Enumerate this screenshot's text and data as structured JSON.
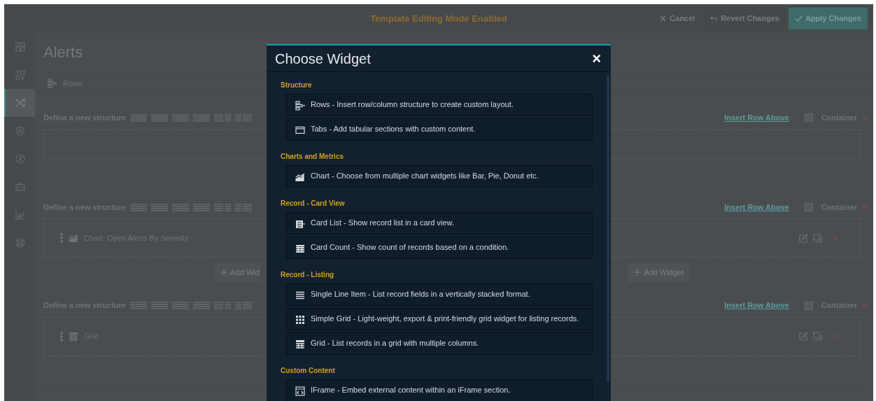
{
  "top_bar": {
    "mode_label": "Template Editing Mode Enabled",
    "buttons": [
      {
        "kind": "cancel",
        "label": "Cancel"
      },
      {
        "kind": "revert",
        "label": "Revert Changes"
      },
      {
        "kind": "apply",
        "label": "Apply Changes"
      }
    ]
  },
  "sidebar": {
    "items": [
      {
        "kind": "dashboard",
        "selected": false
      },
      {
        "kind": "sort",
        "selected": false
      },
      {
        "kind": "shuffle",
        "selected": true
      },
      {
        "kind": "shield",
        "selected": false
      },
      {
        "kind": "compass",
        "selected": false
      },
      {
        "kind": "briefcase",
        "selected": false
      },
      {
        "kind": "chart",
        "selected": false
      },
      {
        "kind": "lifebuoy",
        "selected": false
      }
    ]
  },
  "page": {
    "title": "Alerts",
    "rows_label": "Rows"
  },
  "structures": [
    {
      "label": "Define a new structure",
      "insert_link": "Insert Row Above",
      "container_label": "Container",
      "container_checked": false
    },
    {
      "label": "Define a new structure",
      "insert_link": "Insert Row Above",
      "container_label": "Container",
      "container_checked": false,
      "widgets": [
        {
          "kind": "chart",
          "label": "Chart: Open Alerts By Severity"
        }
      ],
      "add_buttons": [
        "Add Wid",
        "Add Widget"
      ]
    },
    {
      "label": "Define a new structure",
      "insert_link": "Insert Row Above",
      "container_label": "Container",
      "container_checked": false,
      "widgets": [
        {
          "kind": "grid",
          "label": "Grid"
        }
      ]
    }
  ],
  "modal": {
    "title": "Choose Widget",
    "close": "×",
    "groups": [
      {
        "heading": "Structure",
        "items": [
          {
            "kind": "rows",
            "text": "Rows - Insert row/column structure to create custom layout."
          },
          {
            "kind": "tabs",
            "text": "Tabs - Add tabular sections with custom content."
          }
        ]
      },
      {
        "heading": "Charts and Metrics",
        "items": [
          {
            "kind": "chart",
            "text": "Chart - Choose from multiple chart widgets like Bar, Pie, Donut etc."
          }
        ]
      },
      {
        "heading": "Record - Card View",
        "items": [
          {
            "kind": "cardlist",
            "text": "Card List - Show record list in a card view."
          },
          {
            "kind": "cardcount",
            "text": "Card Count - Show count of records based on a condition."
          }
        ]
      },
      {
        "heading": "Record - Listing",
        "items": [
          {
            "kind": "lines",
            "text": "Single Line Item - List record fields in a vertically stacked format."
          },
          {
            "kind": "simplegrid",
            "text": "Simple Grid - Light-weight, export & print-friendly grid widget for listing records."
          },
          {
            "kind": "grid",
            "text": "Grid - List records in a grid with multiple columns."
          }
        ]
      },
      {
        "heading": "Custom Content",
        "items": [
          {
            "kind": "iframe",
            "text": "IFrame - Embed external content within an iFrame section."
          }
        ]
      }
    ]
  }
}
